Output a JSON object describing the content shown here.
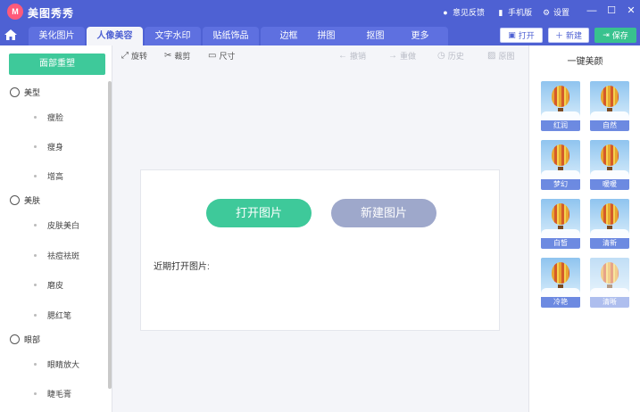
{
  "app": {
    "title": "美图秀秀",
    "logo_text": "M"
  },
  "titlebar": {
    "feedback": "意见反馈",
    "mobile": "手机版",
    "settings": "设置"
  },
  "tabs": [
    {
      "label": "美化图片",
      "active": false
    },
    {
      "label": "人像美容",
      "active": true
    },
    {
      "label": "文字水印",
      "active": false
    },
    {
      "label": "贴纸饰品",
      "active": false
    },
    {
      "label": "边框",
      "active": false
    },
    {
      "label": "拼图",
      "active": false
    },
    {
      "label": "抠图",
      "active": false
    },
    {
      "label": "更多",
      "active": false
    }
  ],
  "top_buttons": {
    "open": "打开",
    "new": "新建",
    "save": "保存"
  },
  "sidebar": {
    "local_button": "面部重塑",
    "sections": [
      {
        "label": "美型",
        "items": [
          "瘦脸",
          "瘦身",
          "增高"
        ]
      },
      {
        "label": "美肤",
        "items": [
          "皮肤美白",
          "祛痘祛斑",
          "磨皮",
          "腮红笔"
        ]
      },
      {
        "label": "眼部",
        "items": [
          "眼睛放大",
          "睫毛膏"
        ]
      }
    ]
  },
  "tools": {
    "rotate": "旋转",
    "crop": "裁剪",
    "size": "尺寸",
    "undo": "撤销",
    "redo": "重做",
    "history": "历史",
    "original": "原图"
  },
  "canvas": {
    "open_button": "打开图片",
    "new_button": "新建图片",
    "recent_label": "近期打开图片:"
  },
  "right_panel": {
    "title": "一键美颜",
    "presets": [
      "红润",
      "自然",
      "梦幻",
      "暖暖",
      "白皙",
      "清新",
      "冷艳",
      "清晰"
    ]
  }
}
